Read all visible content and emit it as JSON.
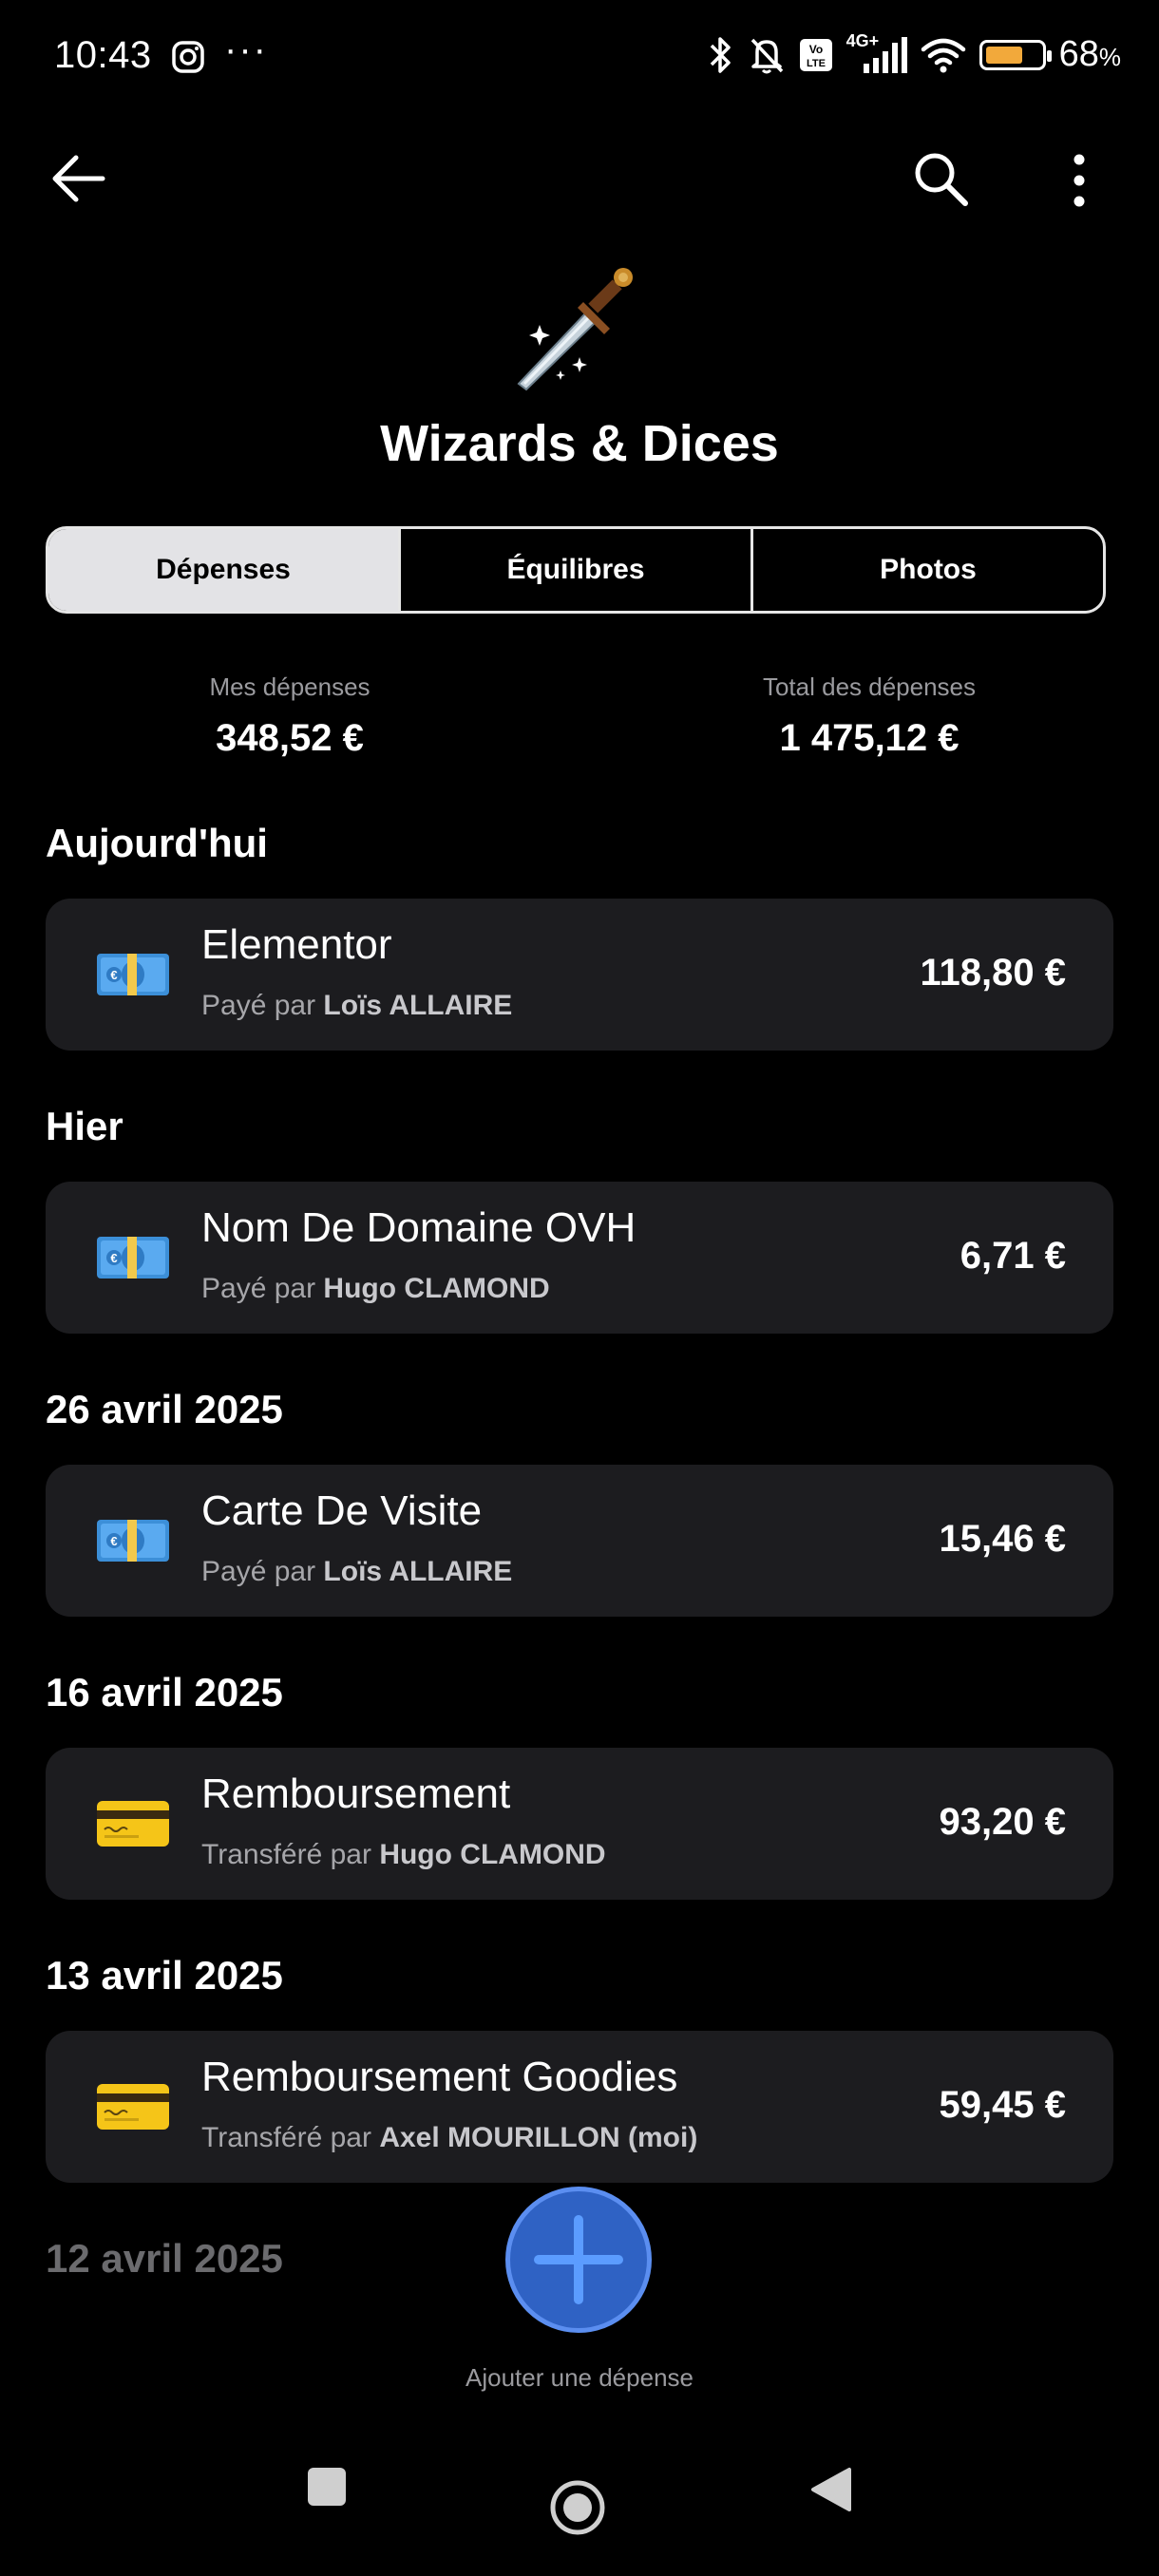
{
  "status_bar": {
    "time": "10:43",
    "dots": "···",
    "network": "4G+",
    "battery_percent": "68",
    "battery_symbol": "%",
    "battery_level": 0.68
  },
  "header": {
    "back_icon": "arrow-left-icon",
    "search_icon": "search-icon",
    "more_icon": "more-vertical-icon"
  },
  "group": {
    "emoji": "dagger-sparkles-icon",
    "title": "Wizards & Dices"
  },
  "tabs": [
    {
      "label": "Dépenses",
      "active": true
    },
    {
      "label": "Équilibres",
      "active": false
    },
    {
      "label": "Photos",
      "active": false
    }
  ],
  "summary": {
    "mine_label": "Mes dépenses",
    "mine_value": "348,52 €",
    "total_label": "Total des dépenses",
    "total_value": "1 475,12 €"
  },
  "sections": [
    {
      "date": "Aujourd'hui",
      "items": [
        {
          "icon": "banknote-icon",
          "name": "Elementor",
          "prefix": "Payé par",
          "person": "Loïs ALLAIRE",
          "amount": "118,80 €"
        }
      ]
    },
    {
      "date": "Hier",
      "items": [
        {
          "icon": "banknote-icon",
          "name": "Nom De Domaine OVH",
          "prefix": "Payé par",
          "person": "Hugo CLAMOND",
          "amount": "6,71 €"
        }
      ]
    },
    {
      "date": "26 avril 2025",
      "items": [
        {
          "icon": "banknote-icon",
          "name": "Carte De Visite",
          "prefix": "Payé par",
          "person": "Loïs ALLAIRE",
          "amount": "15,46 €"
        }
      ]
    },
    {
      "date": "16 avril 2025",
      "items": [
        {
          "icon": "credit-card-icon",
          "name": "Remboursement",
          "prefix": "Transféré par",
          "person": "Hugo CLAMOND",
          "amount": "93,20 €"
        }
      ]
    },
    {
      "date": "13 avril 2025",
      "items": [
        {
          "icon": "credit-card-icon",
          "name": "Remboursement Goodies",
          "prefix": "Transféré par",
          "person": "Axel MOURILLON (moi)",
          "amount": "59,45 €"
        }
      ]
    },
    {
      "date": "12 avril 2025",
      "items": []
    }
  ],
  "fab": {
    "icon": "plus-icon",
    "label": "Ajouter une dépense"
  },
  "nav_bar": {
    "recents": "square-icon",
    "home": "circle-icon",
    "back": "triangle-back-icon"
  },
  "colors": {
    "background": "#000000",
    "card": "#1c1c1f",
    "fab": "#2f62c4",
    "tab_active": "#e3e3e6"
  }
}
